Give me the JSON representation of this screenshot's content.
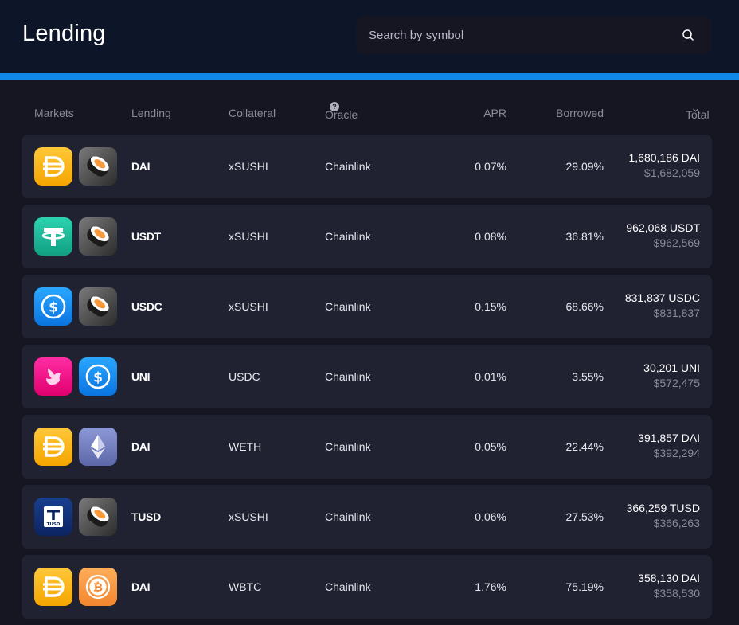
{
  "header": {
    "title": "Lending"
  },
  "search": {
    "placeholder": "Search by symbol"
  },
  "columns": {
    "markets": "Markets",
    "lending": "Lending",
    "collateral": "Collateral",
    "oracle": "Oracle",
    "apr": "APR",
    "borrowed": "Borrowed",
    "total": "Total"
  },
  "colors": {
    "accent": "#1188e6",
    "row_bg": "#202231",
    "header_bg": "#0d1628",
    "page_bg": "#161522"
  },
  "rows": [
    {
      "asset_icon": "dai-icon",
      "collateral_icon": "xsushi-icon",
      "lending": "DAI",
      "collateral": "xSUSHI",
      "oracle": "Chainlink",
      "apr": "0.07%",
      "borrowed": "29.09%",
      "total": "1,680,186 DAI",
      "total_usd": "$1,682,059"
    },
    {
      "asset_icon": "usdt-icon",
      "collateral_icon": "xsushi-icon",
      "lending": "USDT",
      "collateral": "xSUSHI",
      "oracle": "Chainlink",
      "apr": "0.08%",
      "borrowed": "36.81%",
      "total": "962,068 USDT",
      "total_usd": "$962,569"
    },
    {
      "asset_icon": "usdc-icon",
      "collateral_icon": "xsushi-icon",
      "lending": "USDC",
      "collateral": "xSUSHI",
      "oracle": "Chainlink",
      "apr": "0.15%",
      "borrowed": "68.66%",
      "total": "831,837 USDC",
      "total_usd": "$831,837"
    },
    {
      "asset_icon": "uni-icon",
      "collateral_icon": "usdc-icon",
      "lending": "UNI",
      "collateral": "USDC",
      "oracle": "Chainlink",
      "apr": "0.01%",
      "borrowed": "3.55%",
      "total": "30,201 UNI",
      "total_usd": "$572,475"
    },
    {
      "asset_icon": "dai-icon",
      "collateral_icon": "weth-icon",
      "lending": "DAI",
      "collateral": "WETH",
      "oracle": "Chainlink",
      "apr": "0.05%",
      "borrowed": "22.44%",
      "total": "391,857 DAI",
      "total_usd": "$392,294"
    },
    {
      "asset_icon": "tusd-icon",
      "collateral_icon": "xsushi-icon",
      "lending": "TUSD",
      "collateral": "xSUSHI",
      "oracle": "Chainlink",
      "apr": "0.06%",
      "borrowed": "27.53%",
      "total": "366,259 TUSD",
      "total_usd": "$366,263"
    },
    {
      "asset_icon": "dai-icon",
      "collateral_icon": "wbtc-icon",
      "lending": "DAI",
      "collateral": "WBTC",
      "oracle": "Chainlink",
      "apr": "1.76%",
      "borrowed": "75.19%",
      "total": "358,130 DAI",
      "total_usd": "$358,530"
    }
  ]
}
